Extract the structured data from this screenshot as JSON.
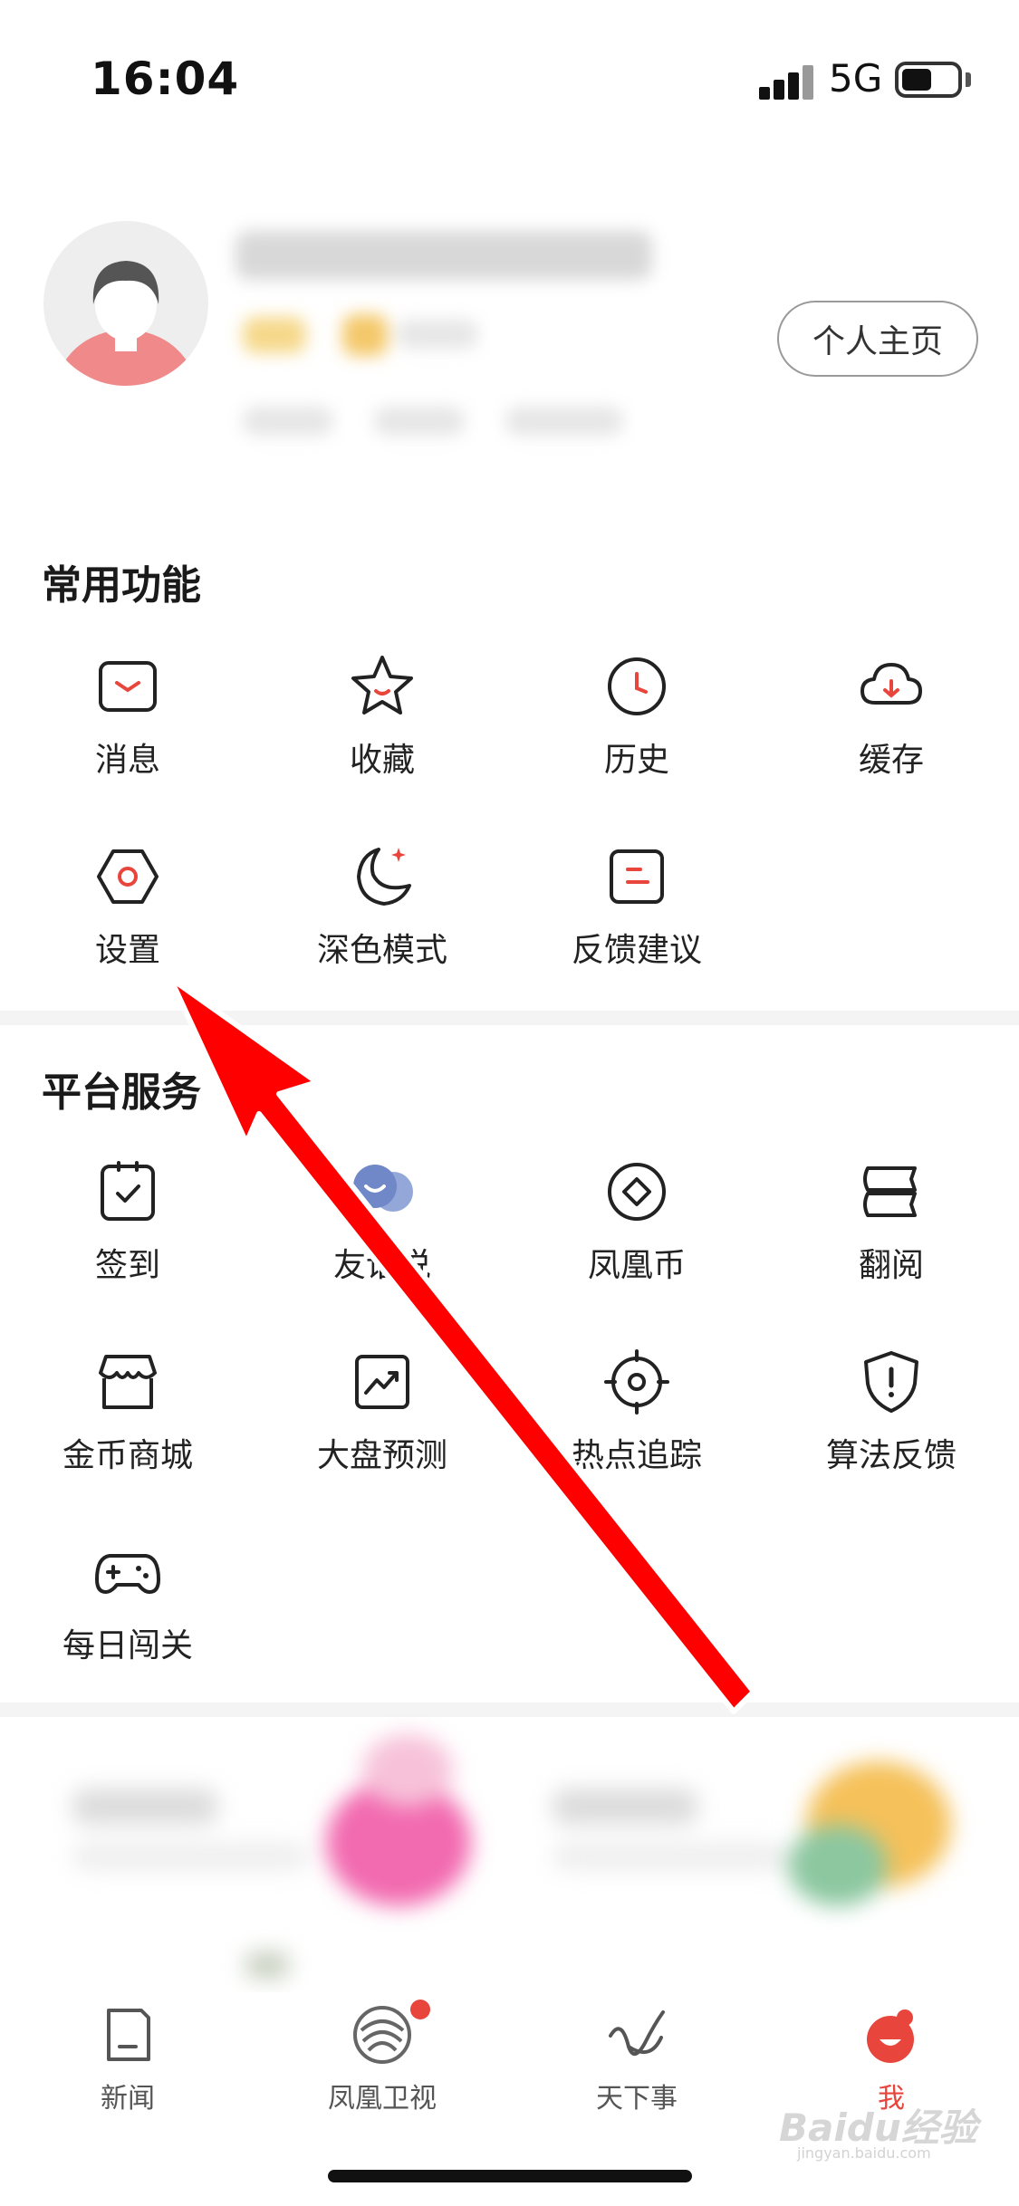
{
  "status_bar": {
    "time": "16:04",
    "network": "5G",
    "battery_level": 0.55
  },
  "profile": {
    "home_button_label": "个人主页"
  },
  "common_functions": {
    "title": "常用功能",
    "items": [
      {
        "label": "消息",
        "icon": "message-icon"
      },
      {
        "label": "收藏",
        "icon": "star-icon"
      },
      {
        "label": "历史",
        "icon": "clock-icon"
      },
      {
        "label": "缓存",
        "icon": "cloud-download-icon"
      },
      {
        "label": "设置",
        "icon": "settings-hexagon-icon"
      },
      {
        "label": "深色模式",
        "icon": "moon-icon"
      },
      {
        "label": "反馈建议",
        "icon": "feedback-icon"
      }
    ]
  },
  "platform_services": {
    "title": "平台服务",
    "items": [
      {
        "label": "签到",
        "icon": "checkin-clipboard-icon"
      },
      {
        "label": "友话说",
        "icon": "chat-bubbles-icon"
      },
      {
        "label": "凤凰币",
        "icon": "coin-diamond-icon"
      },
      {
        "label": "翻阅",
        "icon": "book-stack-icon"
      },
      {
        "label": "金币商城",
        "icon": "shop-icon"
      },
      {
        "label": "大盘预测",
        "icon": "trend-chart-icon"
      },
      {
        "label": "热点追踪",
        "icon": "crosshair-icon"
      },
      {
        "label": "算法反馈",
        "icon": "shield-alert-icon"
      },
      {
        "label": "每日闯关",
        "icon": "gamepad-icon"
      }
    ]
  },
  "tab_bar": {
    "tabs": [
      {
        "label": "新闻",
        "icon": "news-icon",
        "active": false
      },
      {
        "label": "凤凰卫视",
        "icon": "phoenix-logo-icon",
        "active": false,
        "badge": true
      },
      {
        "label": "天下事",
        "icon": "swirl-icon",
        "active": false
      },
      {
        "label": "我",
        "icon": "me-face-icon",
        "active": true
      }
    ]
  },
  "colors": {
    "accent": "#e8453c",
    "arrow": "#ff0000",
    "text": "#222222"
  },
  "watermark": {
    "brand": "Baidu经验",
    "url": "jingyan.baidu.com"
  }
}
